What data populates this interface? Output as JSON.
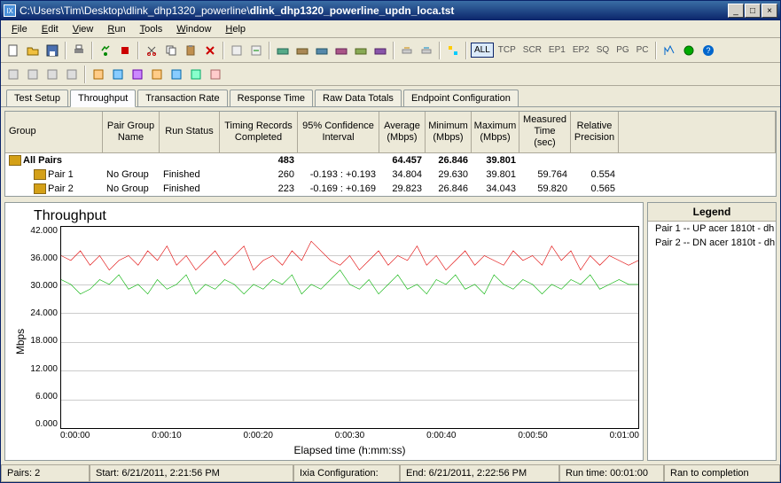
{
  "titlebar": {
    "path_prefix": "C:\\Users\\Tim\\Desktop\\dlink_dhp1320_powerline\\",
    "filename": "dlink_dhp1320_powerline_updn_loca.tst"
  },
  "menu": {
    "file": "File",
    "edit": "Edit",
    "view": "View",
    "run": "Run",
    "tools": "Tools",
    "window": "Window",
    "help": "Help"
  },
  "toolbar_text": {
    "all": "ALL",
    "tcp": "TCP",
    "scr": "SCR",
    "ep1": "EP1",
    "ep2": "EP2",
    "sq": "SQ",
    "pg": "PG",
    "pc": "PC"
  },
  "tabs": {
    "test_setup": "Test Setup",
    "throughput": "Throughput",
    "transaction_rate": "Transaction Rate",
    "response_time": "Response Time",
    "raw_data_totals": "Raw Data Totals",
    "endpoint_configuration": "Endpoint Configuration"
  },
  "grid": {
    "headers": {
      "group": "Group",
      "pair_group_name": "Pair Group\nName",
      "run_status": "Run Status",
      "timing_records_completed": "Timing Records\nCompleted",
      "conf_interval": "95% Confidence\nInterval",
      "average": "Average\n(Mbps)",
      "minimum": "Minimum\n(Mbps)",
      "maximum": "Maximum\n(Mbps)",
      "measured_time": "Measured\nTime (sec)",
      "relative_precision": "Relative\nPrecision"
    },
    "rows": [
      {
        "group": "All Pairs",
        "pgname": "",
        "status": "",
        "trc": "483",
        "ci": "",
        "avg": "64.457",
        "min": "26.846",
        "max": "39.801",
        "mt": "",
        "rp": "",
        "bold": true,
        "icon": true
      },
      {
        "group": "Pair 1",
        "pgname": "No Group",
        "status": "Finished",
        "trc": "260",
        "ci": "-0.193 : +0.193",
        "avg": "34.804",
        "min": "29.630",
        "max": "39.801",
        "mt": "59.764",
        "rp": "0.554",
        "bold": false,
        "icon": true,
        "indent": true
      },
      {
        "group": "Pair 2",
        "pgname": "No Group",
        "status": "Finished",
        "trc": "223",
        "ci": "-0.169 : +0.169",
        "avg": "29.823",
        "min": "26.846",
        "max": "34.043",
        "mt": "59.820",
        "rp": "0.565",
        "bold": false,
        "icon": true,
        "indent": true
      }
    ]
  },
  "chart_data": {
    "type": "line",
    "title": "Throughput",
    "xlabel": "Elapsed time (h:mm:ss)",
    "ylabel": "Mbps",
    "ylim": [
      0,
      42
    ],
    "yticks": [
      "42.000",
      "36.000",
      "30.000",
      "24.000",
      "18.000",
      "12.000",
      "6.000",
      "0.000"
    ],
    "xticks": [
      "0:00:00",
      "0:00:10",
      "0:00:20",
      "0:00:30",
      "0:00:40",
      "0:00:50",
      "0:01:00"
    ],
    "x": [
      0,
      1,
      2,
      3,
      4,
      5,
      6,
      7,
      8,
      9,
      10,
      11,
      12,
      13,
      14,
      15,
      16,
      17,
      18,
      19,
      20,
      21,
      22,
      23,
      24,
      25,
      26,
      27,
      28,
      29,
      30,
      31,
      32,
      33,
      34,
      35,
      36,
      37,
      38,
      39,
      40,
      41,
      42,
      43,
      44,
      45,
      46,
      47,
      48,
      49,
      50,
      51,
      52,
      53,
      54,
      55,
      56,
      57,
      58,
      59,
      60
    ],
    "series": [
      {
        "name": "Pair 1 -- UP acer 1810t - dh",
        "color": "#e00000",
        "values": [
          36,
          35,
          37,
          34,
          36,
          33,
          35,
          36,
          34,
          37,
          35,
          38,
          34,
          36,
          33,
          35,
          37,
          34,
          36,
          38,
          33,
          35,
          36,
          34,
          37,
          35,
          39,
          37,
          35,
          34,
          36,
          33,
          35,
          37,
          34,
          36,
          35,
          38,
          34,
          36,
          33,
          35,
          37,
          34,
          36,
          35,
          34,
          37,
          35,
          36,
          34,
          38,
          35,
          37,
          33,
          36,
          34,
          36,
          35,
          34,
          35
        ]
      },
      {
        "name": "Pair 2 -- DN acer 1810t - dh",
        "color": "#00b000",
        "values": [
          31,
          30,
          28,
          29,
          31,
          30,
          32,
          29,
          30,
          28,
          31,
          29,
          30,
          32,
          28,
          30,
          29,
          31,
          30,
          28,
          30,
          29,
          31,
          30,
          32,
          28,
          30,
          29,
          31,
          33,
          30,
          29,
          31,
          28,
          30,
          32,
          29,
          30,
          28,
          31,
          30,
          32,
          29,
          30,
          28,
          32,
          30,
          29,
          31,
          30,
          28,
          30,
          29,
          31,
          30,
          32,
          29,
          30,
          31,
          30,
          30
        ]
      }
    ],
    "legend_title": "Legend"
  },
  "status": {
    "pairs": "Pairs: 2",
    "start": "Start: 6/21/2011, 2:21:56 PM",
    "ixia": "Ixia Configuration:",
    "end": "End: 6/21/2011, 2:22:56 PM",
    "runtime": "Run time: 00:01:00",
    "ran": "Ran to completion"
  }
}
